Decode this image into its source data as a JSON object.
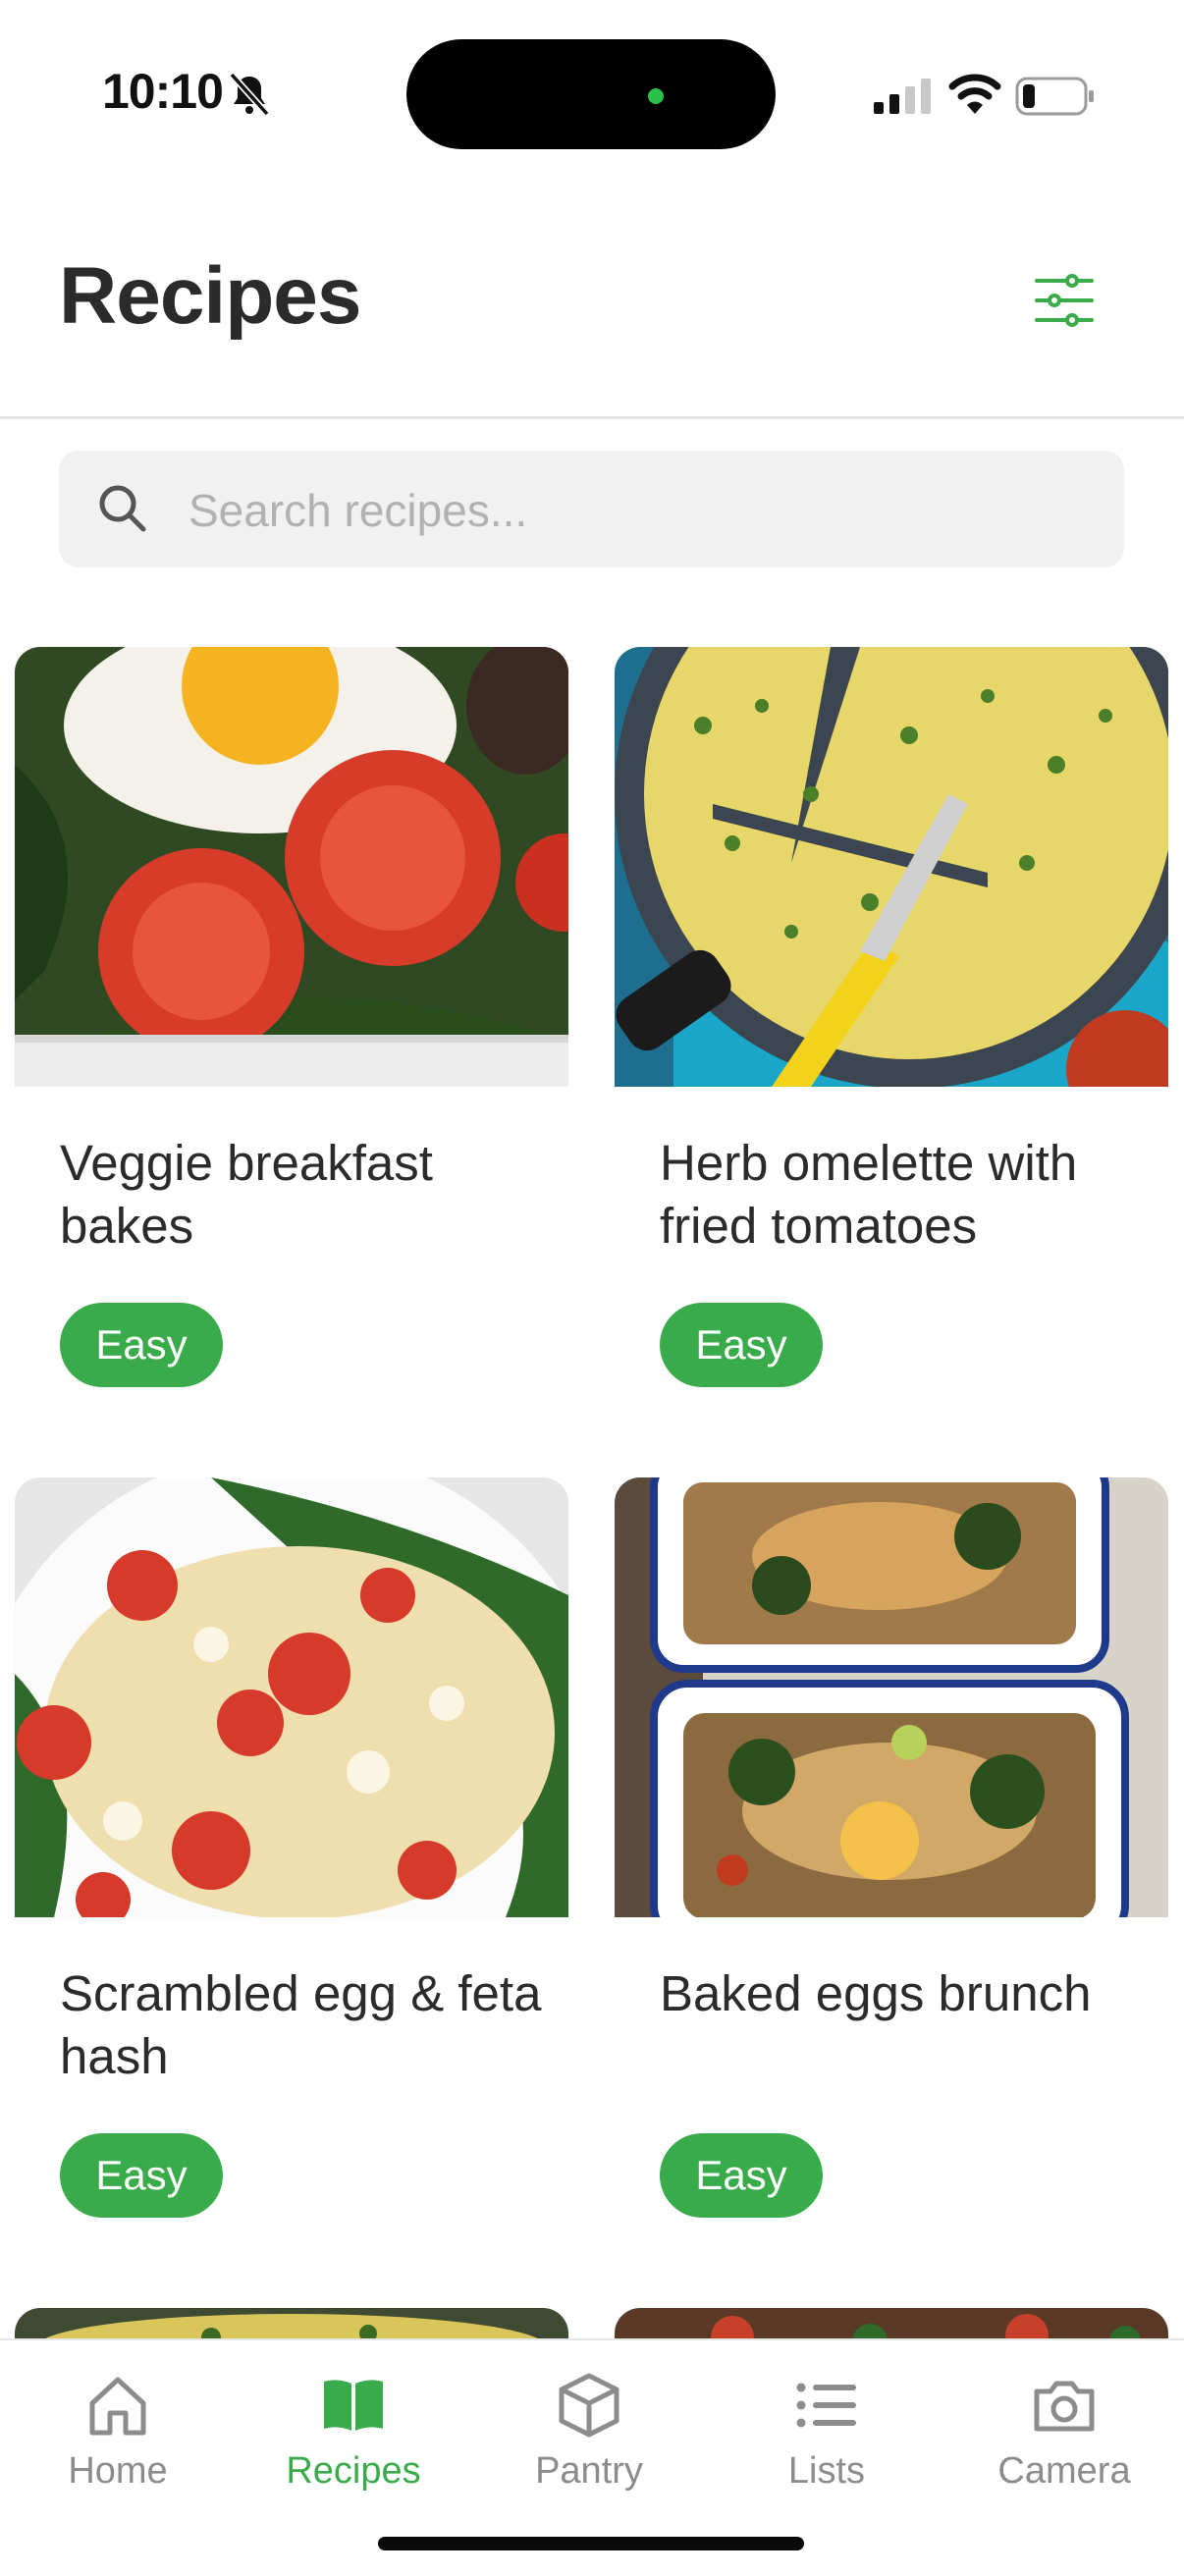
{
  "status_bar": {
    "time": "10:10"
  },
  "header": {
    "title": "Recipes"
  },
  "search": {
    "placeholder": "Search recipes..."
  },
  "recipes": [
    {
      "title": "Veggie breakfast bakes",
      "difficulty": "Easy"
    },
    {
      "title": "Herb omelette with fried tomatoes",
      "difficulty": "Easy"
    },
    {
      "title": "Scrambled egg & feta hash",
      "difficulty": "Easy"
    },
    {
      "title": "Baked eggs brunch",
      "difficulty": "Easy"
    }
  ],
  "nav": {
    "items": [
      {
        "label": "Home",
        "icon": "home-icon"
      },
      {
        "label": "Recipes",
        "icon": "book-icon",
        "active": true
      },
      {
        "label": "Pantry",
        "icon": "box-icon"
      },
      {
        "label": "Lists",
        "icon": "list-icon"
      },
      {
        "label": "Camera",
        "icon": "camera-icon"
      }
    ]
  },
  "colors": {
    "accent": "#3aab4b",
    "text": "#2b2b2b",
    "muted": "#8c8c8c",
    "search_bg": "#f1f1f1"
  }
}
